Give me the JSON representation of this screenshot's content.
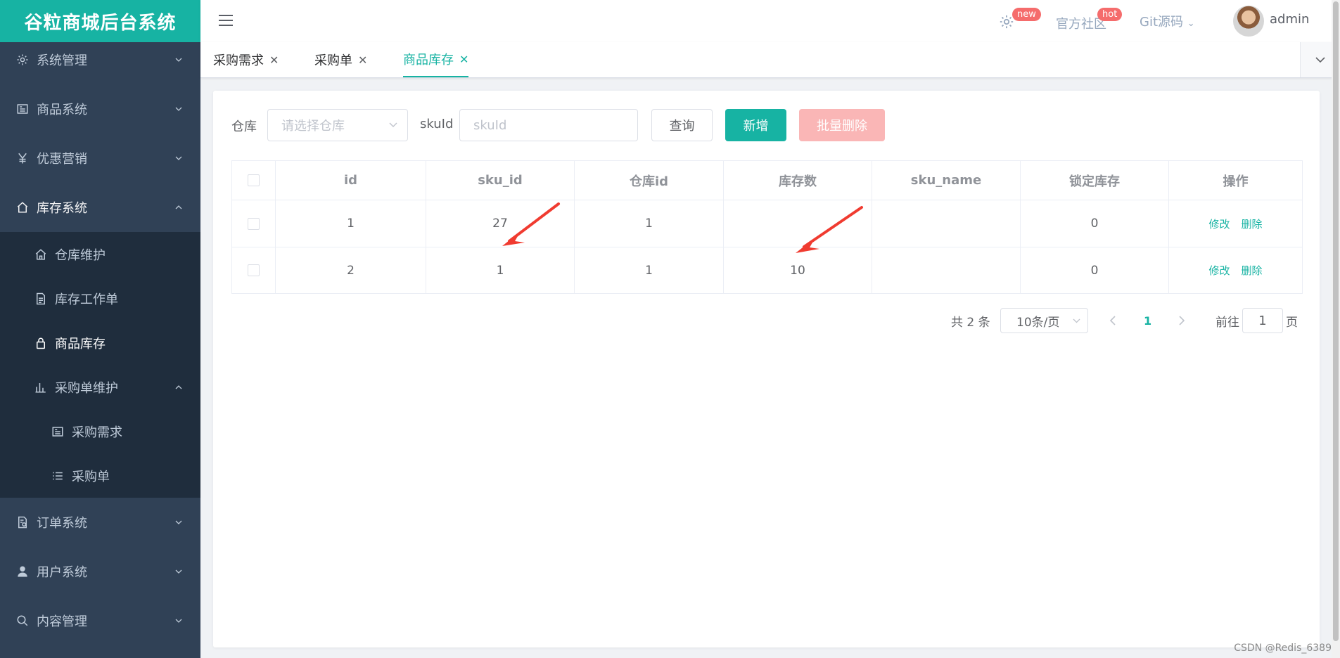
{
  "app": {
    "logo": "谷粒商城后台系统"
  },
  "colors": {
    "primary": "#17b3a3",
    "sidebar_bg": "#304156",
    "submenu_bg": "#1f2d3d",
    "danger": "#f56c6c",
    "danger_light": "#fab6b6"
  },
  "sidebar": {
    "items": [
      {
        "label": "系统管理",
        "icon": "gear-icon"
      },
      {
        "label": "商品系统",
        "icon": "picture-icon"
      },
      {
        "label": "优惠营销",
        "icon": "yen-icon"
      },
      {
        "label": "库存系统",
        "icon": "home-icon",
        "open": true,
        "children": [
          {
            "label": "仓库维护",
            "icon": "house-icon"
          },
          {
            "label": "库存工作单",
            "icon": "document-icon"
          },
          {
            "label": "商品库存",
            "icon": "lock-icon",
            "active": true
          },
          {
            "label": "采购单维护",
            "icon": "bar-chart-icon",
            "open": true,
            "children": [
              {
                "label": "采购需求",
                "icon": "picture-icon"
              },
              {
                "label": "采购单",
                "icon": "list-icon"
              }
            ]
          }
        ]
      },
      {
        "label": "订单系统",
        "icon": "order-icon"
      },
      {
        "label": "用户系统",
        "icon": "user-icon"
      },
      {
        "label": "内容管理",
        "icon": "search-icon"
      }
    ]
  },
  "navbar": {
    "settings_badge": "new",
    "community": "官方社区",
    "community_badge": "hot",
    "git": "Git源码",
    "username": "admin"
  },
  "tabs": [
    {
      "label": "采购需求",
      "active": false
    },
    {
      "label": "采购单",
      "active": false
    },
    {
      "label": "商品库存",
      "active": true
    }
  ],
  "search": {
    "warehouse_label": "仓库",
    "warehouse_placeholder": "请选择仓库",
    "skuid_label": "skuId",
    "skuid_placeholder": "skuId",
    "query_button": "查询",
    "add_button": "新增",
    "batch_delete_button": "批量删除"
  },
  "table": {
    "columns": [
      "id",
      "sku_id",
      "仓库id",
      "库存数",
      "sku_name",
      "锁定库存",
      "操作"
    ],
    "rows": [
      {
        "id": "1",
        "sku_id": "27",
        "ware_id": "1",
        "stock": "",
        "sku_name": "",
        "locked": "0"
      },
      {
        "id": "2",
        "sku_id": "1",
        "ware_id": "1",
        "stock": "10",
        "sku_name": "",
        "locked": "0"
      }
    ],
    "edit_label": "修改",
    "delete_label": "删除"
  },
  "pagination": {
    "total": "共 2 条",
    "page_size": "10条/页",
    "current_page": "1",
    "goto_prefix": "前往",
    "goto_value": "1",
    "goto_suffix": "页"
  },
  "watermark": "CSDN @Redis_6389"
}
